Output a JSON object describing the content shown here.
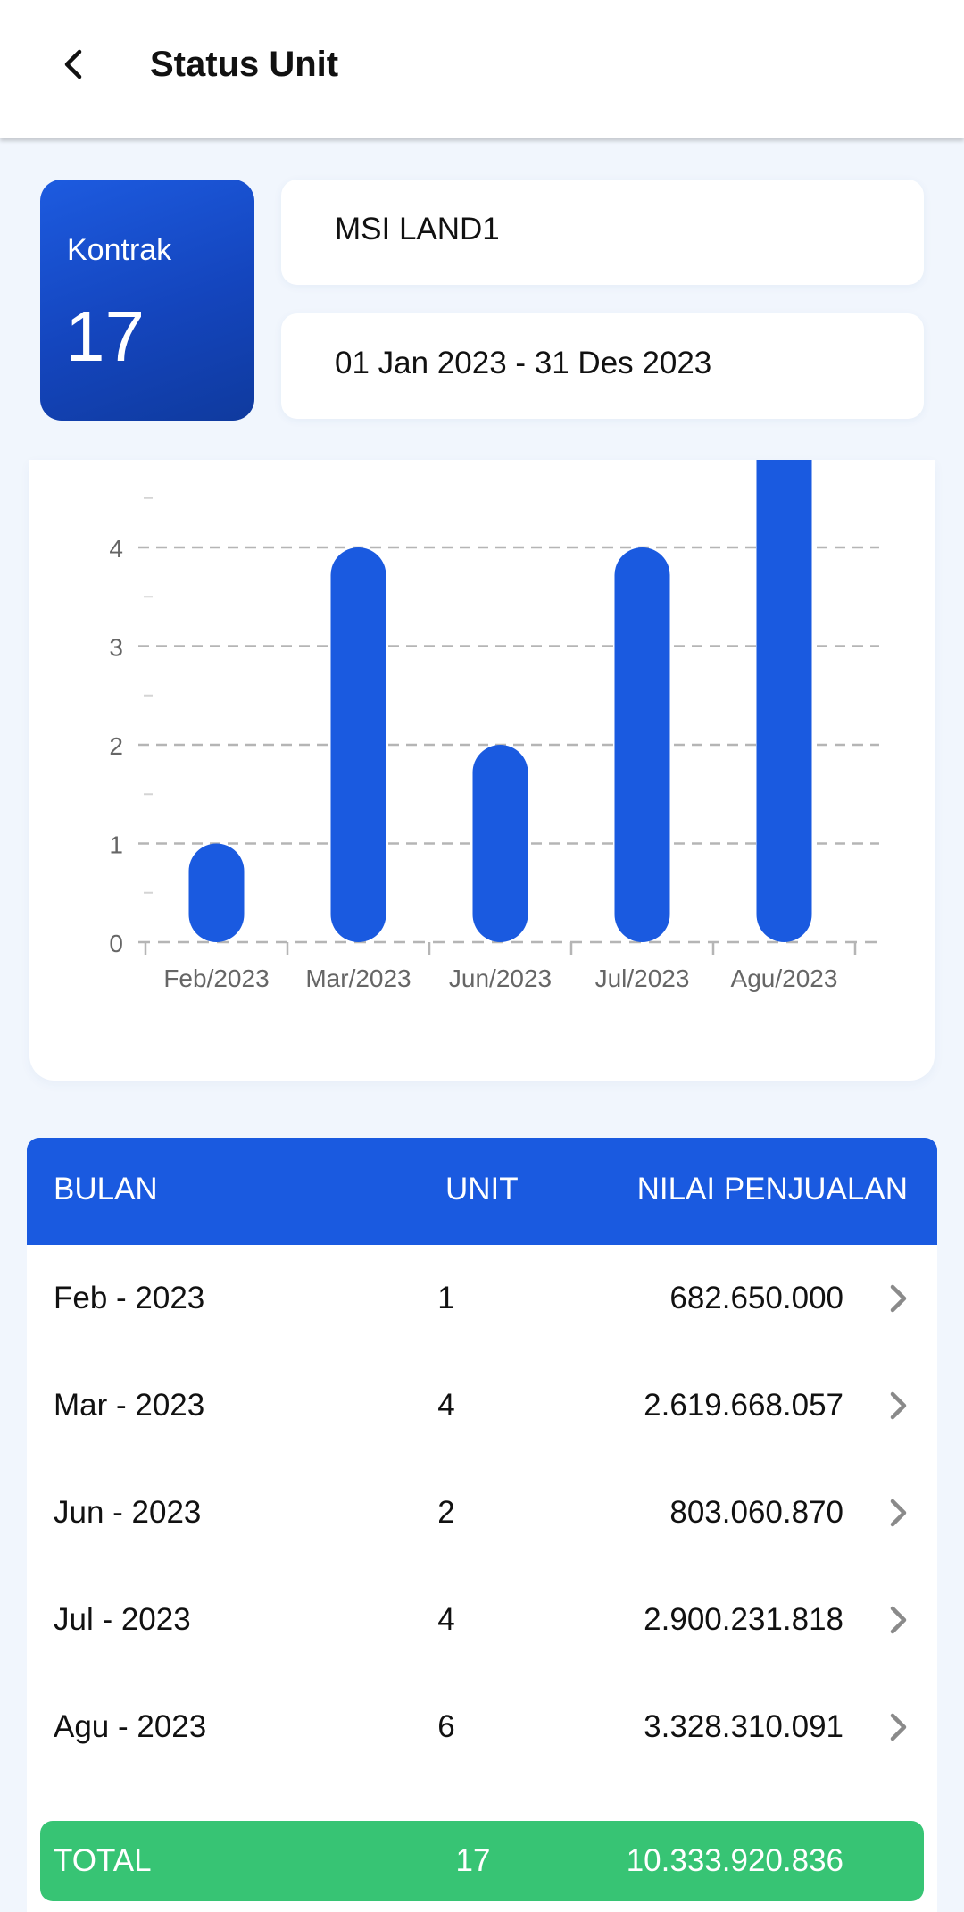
{
  "header": {
    "title": "Status Unit"
  },
  "kontrak": {
    "label": "Kontrak",
    "value": "17"
  },
  "filters": {
    "project": "MSI LAND1",
    "period": "01 Jan 2023 - 31 Des 2023"
  },
  "colors": {
    "primary": "#1a5ae0",
    "total": "#37c474",
    "grid": "#b5b5b5",
    "axis_text": "#666666"
  },
  "chart_data": {
    "type": "bar",
    "categories": [
      "Feb/2023",
      "Mar/2023",
      "Jun/2023",
      "Jul/2023",
      "Agu/2023"
    ],
    "values": [
      1,
      4,
      2,
      4,
      6
    ],
    "yticks": [
      0,
      1,
      2,
      3,
      4
    ],
    "ylim": [
      0,
      4.5
    ],
    "grid": true,
    "bar_color": "#1a5ae0"
  },
  "table": {
    "headers": {
      "month": "BULAN",
      "unit": "UNIT",
      "value": "NILAI PENJUALAN"
    },
    "rows": [
      {
        "month": "Feb - 2023",
        "unit": "1",
        "value": "682.650.000"
      },
      {
        "month": "Mar - 2023",
        "unit": "4",
        "value": "2.619.668.057"
      },
      {
        "month": "Jun - 2023",
        "unit": "2",
        "value": "803.060.870"
      },
      {
        "month": "Jul - 2023",
        "unit": "4",
        "value": "2.900.231.818"
      },
      {
        "month": "Agu - 2023",
        "unit": "6",
        "value": "3.328.310.091"
      }
    ],
    "total": {
      "label": "TOTAL",
      "unit": "17",
      "value": "10.333.920.836"
    }
  },
  "icons": {
    "back": "back-arrow-icon",
    "row_chevron": "chevron-right-icon"
  }
}
